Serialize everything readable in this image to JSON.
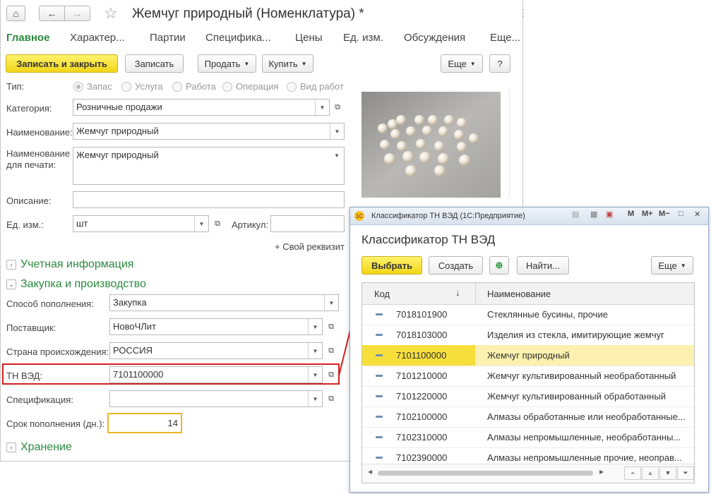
{
  "main": {
    "title": "Жемчуг природный (Номенклатура) *",
    "nav": {
      "home": "⌂",
      "back": "←",
      "forward": "→",
      "star": "☆",
      "more": "⋮"
    },
    "tabs": [
      "Главное",
      "Характер...",
      "Партии",
      "Специфика...",
      "Цены",
      "Ед. изм.",
      "Обсуждения",
      "Еще..."
    ],
    "toolbar": {
      "save_close": "Записать и закрыть",
      "save": "Записать",
      "sell": "Продать",
      "buy": "Купить",
      "more": "Еще",
      "help": "?"
    },
    "type_label": "Тип:",
    "type_options": [
      "Запас",
      "Услуга",
      "Работа",
      "Операция",
      "Вид работ"
    ],
    "category": {
      "label": "Категория:",
      "value": "Розничные продажи"
    },
    "name": {
      "label": "Наименование:",
      "value": "Жемчуг природный"
    },
    "print_name": {
      "label1": "Наименование",
      "label2": "для печати:",
      "value": "Жемчуг природный"
    },
    "description": {
      "label": "Описание:",
      "value": ""
    },
    "unit": {
      "label": "Ед. изм.:",
      "value": "шт"
    },
    "article": {
      "label": "Артикул:",
      "value": ""
    },
    "add_prop": "+ Свой реквизит",
    "sec_accounting": "Учетная информация",
    "sec_purchase": "Закупка и производство",
    "replenish": {
      "label": "Способ пополнения:",
      "value": "Закупка"
    },
    "supplier": {
      "label": "Поставщик:",
      "value": "НовоЧЛит"
    },
    "country": {
      "label": "Страна происхождения:",
      "value": "РОССИЯ"
    },
    "tnved": {
      "label": "ТН ВЭД:",
      "value": "7101100000"
    },
    "spec": {
      "label": "Спецификация:",
      "value": ""
    },
    "term": {
      "label": "Срок пополнения (дн.):",
      "value": "14"
    },
    "sec_storage": "Хранение"
  },
  "dialog": {
    "caption": "Классификатор ТН ВЭД  (1С:Предприятие)",
    "caption_buttons": [
      "M",
      "M+",
      "M−",
      "□",
      "✕"
    ],
    "header": "Классификатор ТН ВЭД",
    "buttons": {
      "select": "Выбрать",
      "create": "Создать",
      "find": "Найти...",
      "more": "Еще"
    },
    "columns": {
      "code": "Код",
      "name": "Наименование",
      "sort": "↓"
    },
    "rows": [
      {
        "code": "7018101900",
        "name": "Стеклянные бусины, прочие"
      },
      {
        "code": "7018103000",
        "name": "Изделия из стекла, имитирующие жемчуг"
      },
      {
        "code": "7101100000",
        "name": "Жемчуг природный"
      },
      {
        "code": "7101210000",
        "name": "Жемчуг культивированный необработанный"
      },
      {
        "code": "7101220000",
        "name": "Жемчуг культивированный обработанный"
      },
      {
        "code": "7102100000",
        "name": "Алмазы обработанные или необработанные..."
      },
      {
        "code": "7102310000",
        "name": "Алмазы непромышленные, необработанны..."
      },
      {
        "code": "7102390000",
        "name": "Алмазы непромышленные прочие, неоправ..."
      }
    ],
    "selected_index": 2
  },
  "colors": {
    "accent_green": "#2b8a3e",
    "highlight_red": "#d42020",
    "selection_yellow": "#f6df3a",
    "focus_orange": "#f0b429"
  }
}
